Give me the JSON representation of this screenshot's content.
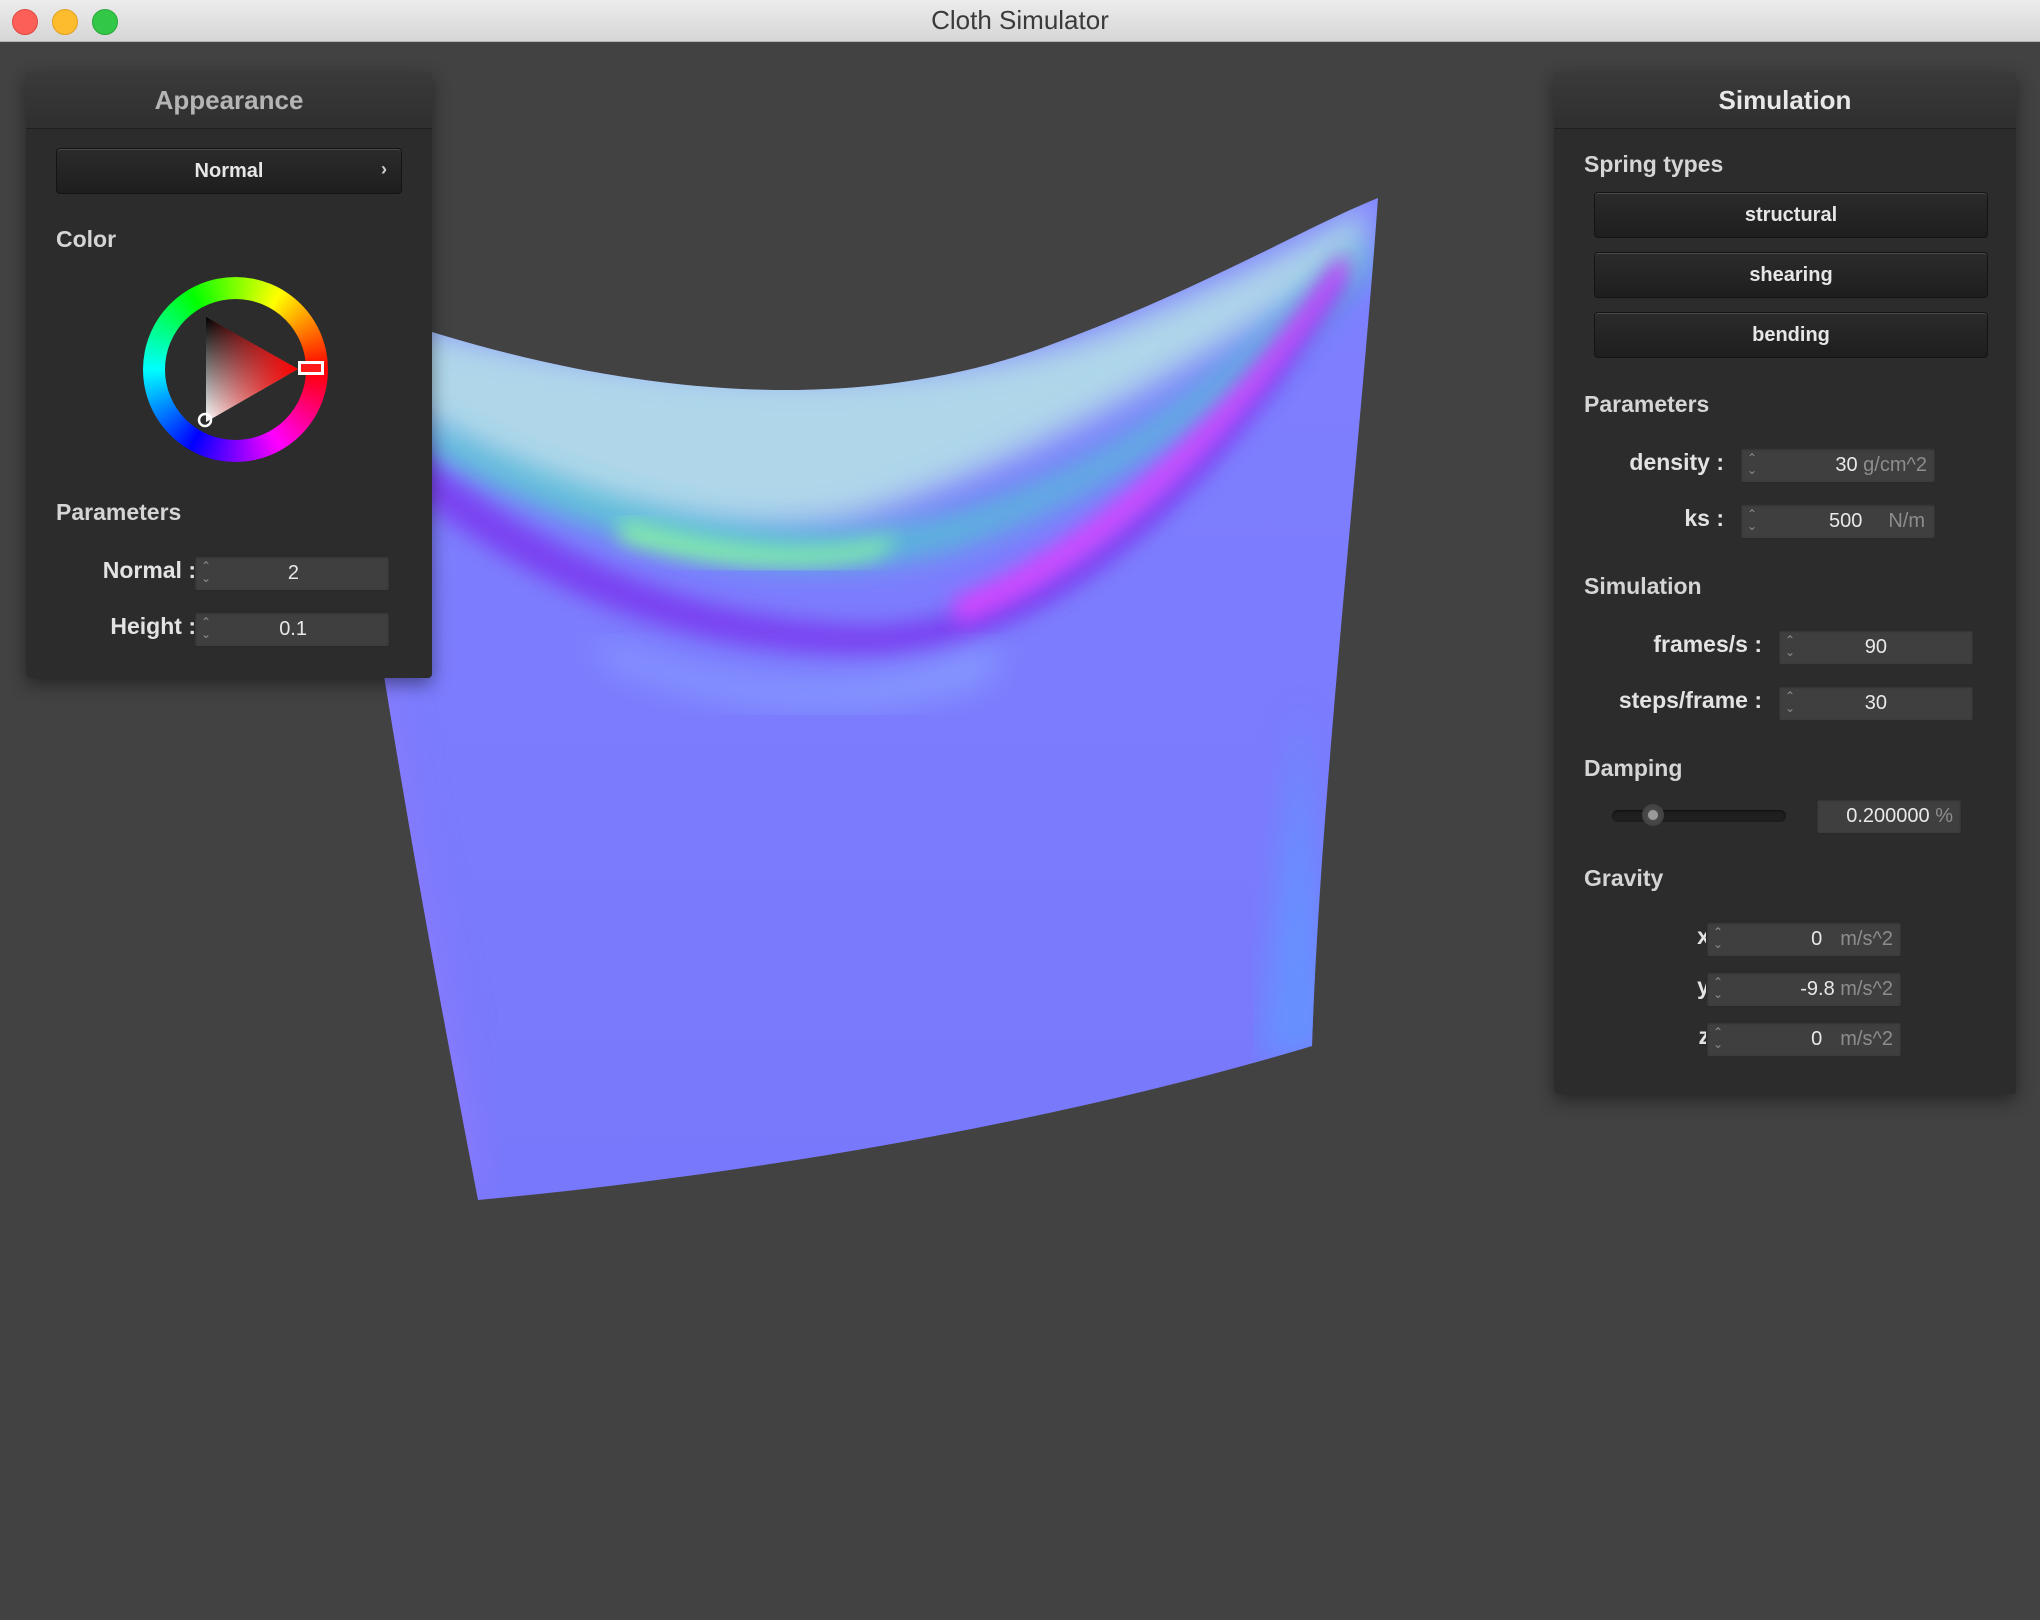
{
  "window": {
    "title": "Cloth Simulator"
  },
  "appearance": {
    "title": "Appearance",
    "shader_select": "Normal",
    "color_label": "Color",
    "params_label": "Parameters",
    "normal_label": "Normal :",
    "normal_value": "2",
    "height_label": "Height :",
    "height_value": "0.1",
    "selected_color": "#ff0000"
  },
  "simulation": {
    "title": "Simulation",
    "spring_types_label": "Spring types",
    "spring_buttons": [
      "structural",
      "shearing",
      "bending"
    ],
    "params_label": "Parameters",
    "density_label": "density :",
    "density_value": "30",
    "density_unit": "g/cm^2",
    "ks_label": "ks :",
    "ks_value": "500",
    "ks_unit": "N/m",
    "sim_label": "Simulation",
    "fps_label": "frames/s :",
    "fps_value": "90",
    "steps_label": "steps/frame :",
    "steps_value": "30",
    "damping_label": "Damping",
    "damping_value": "0.200000",
    "damping_unit": "%",
    "damping_slider_fraction": 0.2,
    "gravity_label": "Gravity",
    "gx_label": "x :",
    "gx_value": "0",
    "gy_label": "y :",
    "gy_value": "-9.8",
    "gz_label": "z :",
    "gz_value": "0",
    "gravity_unit": "m/s^2"
  }
}
